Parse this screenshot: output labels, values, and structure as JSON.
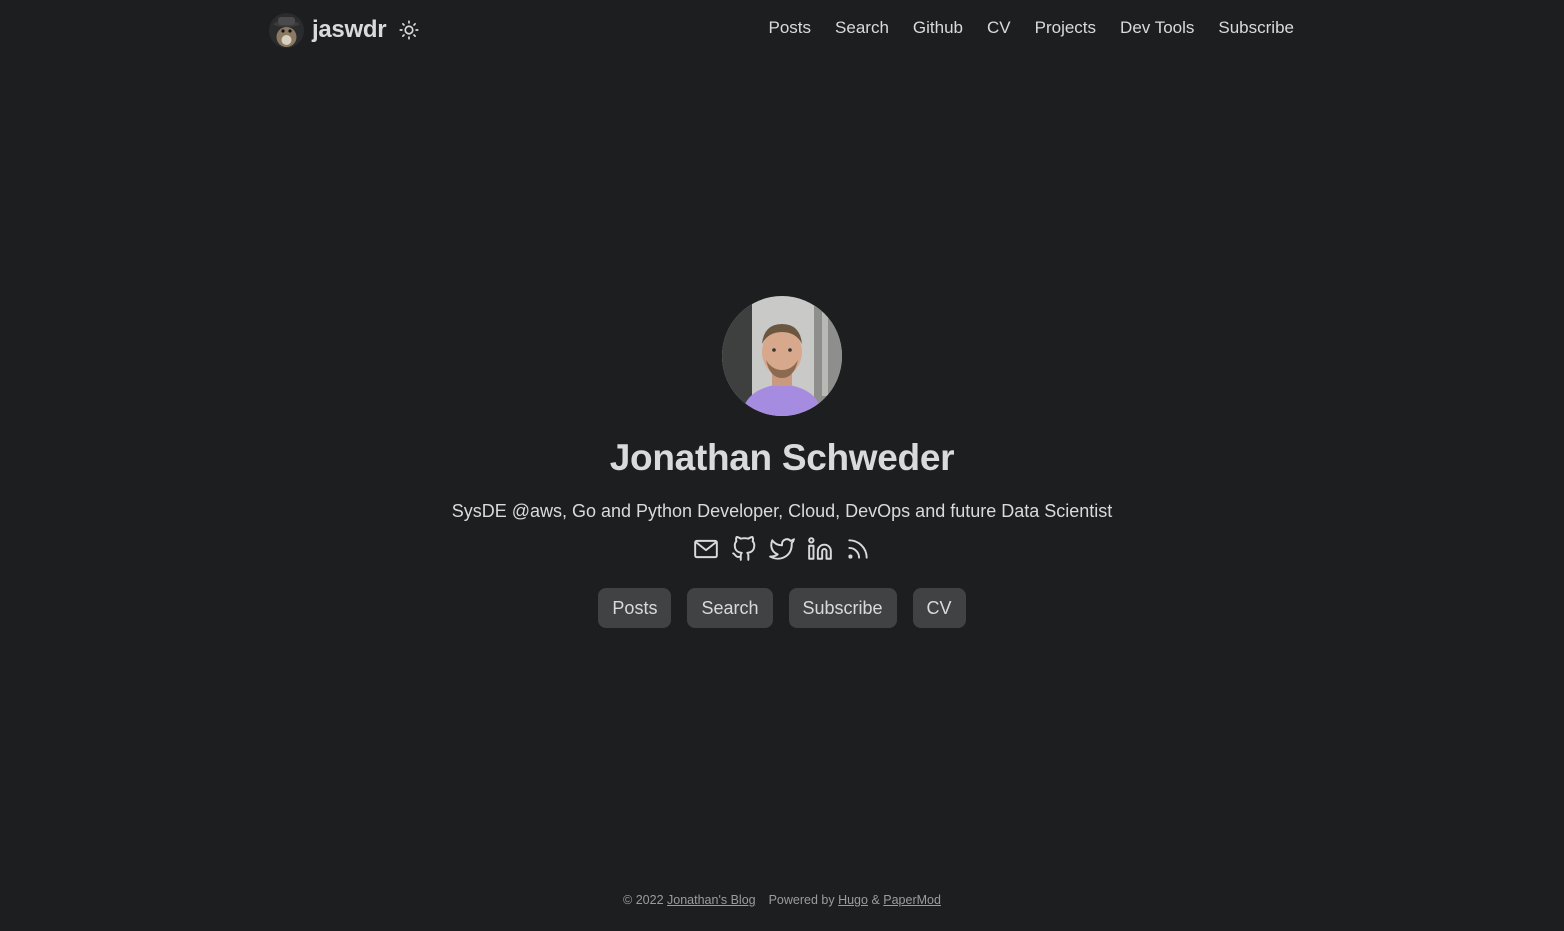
{
  "header": {
    "logo_text": "jaswdr",
    "menu": [
      {
        "label": "Posts"
      },
      {
        "label": "Search"
      },
      {
        "label": "Github"
      },
      {
        "label": "CV"
      },
      {
        "label": "Projects"
      },
      {
        "label": "Dev Tools"
      },
      {
        "label": "Subscribe"
      }
    ]
  },
  "profile": {
    "name": "Jonathan Schweder",
    "subtitle": "SysDE @aws, Go and Python Developer, Cloud, DevOps and future Data Scientist",
    "social_icons": [
      "email-icon",
      "github-icon",
      "twitter-icon",
      "linkedin-icon",
      "rss-icon"
    ],
    "buttons": [
      {
        "label": "Posts"
      },
      {
        "label": "Search"
      },
      {
        "label": "Subscribe"
      },
      {
        "label": "CV"
      }
    ]
  },
  "footer": {
    "copyright": "© 2022",
    "blog_link": "Jonathan's Blog",
    "powered_by": "Powered by",
    "hugo_link": "Hugo",
    "amp": "&",
    "papermod_link": "PaperMod"
  },
  "colors": {
    "background": "#1d1e20",
    "text": "#dadadb",
    "button_bg": "#414244",
    "footer_text": "#9b9c9d"
  }
}
